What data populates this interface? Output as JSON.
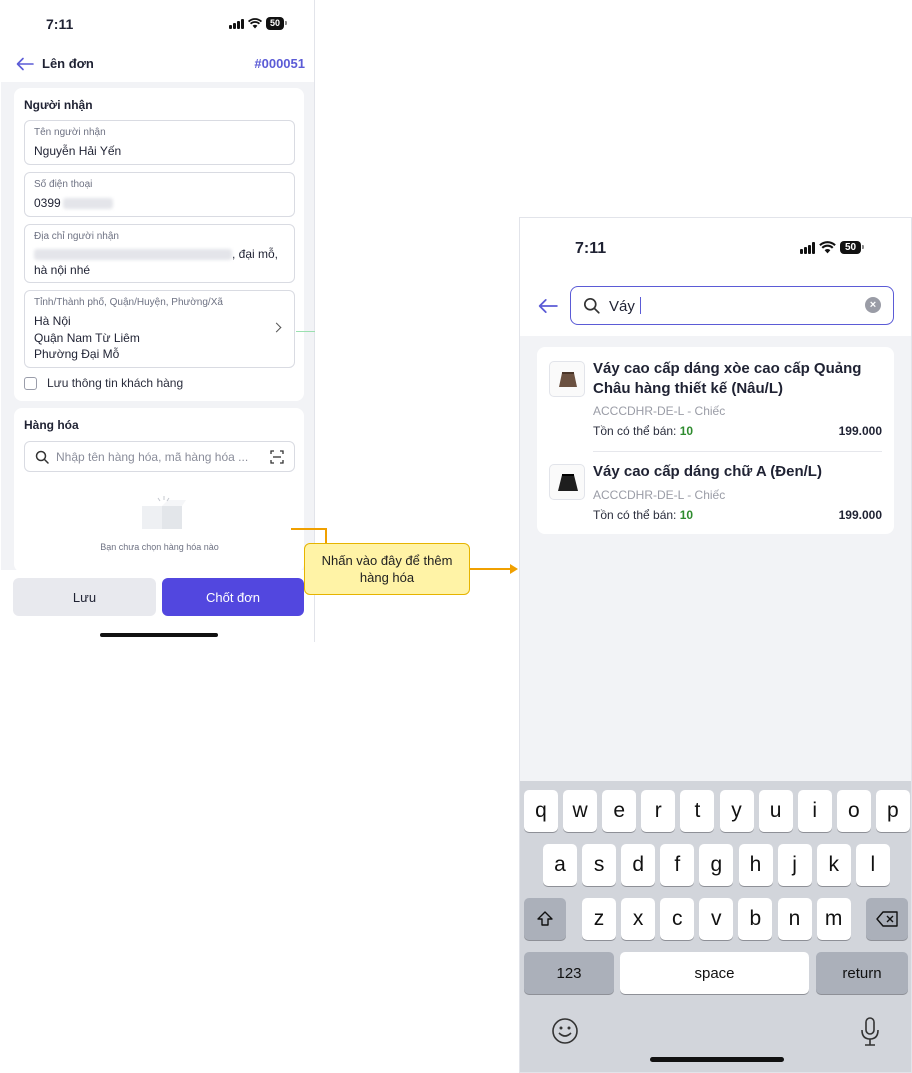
{
  "left_screen": {
    "status_time": "7:11",
    "battery": "50",
    "header": {
      "title": "Lên đơn",
      "order_number": "#000051"
    },
    "recipient": {
      "section_title": "Người nhận",
      "name": {
        "label": "Tên người nhận",
        "value": "Nguyễn Hải Yến"
      },
      "phone": {
        "label": "Số điện thoại",
        "value": "0399"
      },
      "address": {
        "label": "Địa chỉ người nhận",
        "value_line1_tail": ", đại mỗ,",
        "value_line2": "hà nội nhé"
      },
      "region": {
        "label": "Tỉnh/Thành phố, Quận/Huyện, Phường/Xã",
        "province": "Hà Nội",
        "district": "Quận Nam Từ Liêm",
        "ward": "Phường Đại Mỗ"
      },
      "save_customer_label": "Lưu thông tin khách hàng"
    },
    "goods": {
      "section_title": "Hàng hóa",
      "search_placeholder": "Nhập tên hàng hóa, mã hàng hóa ...",
      "empty_text": "Bạn chưa chọn hàng hóa nào"
    },
    "buttons": {
      "save": "Lưu",
      "confirm": "Chốt đơn"
    }
  },
  "callout": {
    "text": "Nhấn vào đây để thêm hàng hóa"
  },
  "right_screen": {
    "status_time": "7:11",
    "battery": "50",
    "search_query": "Váy",
    "results": [
      {
        "name": "Váy cao cấp dáng xòe cao cấp Quảng Châu hàng thiết kế (Nâu/L)",
        "sku": "ACCCDHR-DE-L - Chiếc",
        "stock_label": "Tồn có thể bán:",
        "stock": "10",
        "price": "199.000"
      },
      {
        "name": "Váy cao cấp dáng chữ A (Đen/L)",
        "sku": "ACCCDHR-DE-L - Chiếc",
        "stock_label": "Tồn có thể bán:",
        "stock": "10",
        "price": "199.000"
      }
    ],
    "keyboard": {
      "row1": [
        "q",
        "w",
        "e",
        "r",
        "t",
        "y",
        "u",
        "i",
        "o",
        "p"
      ],
      "row2": [
        "a",
        "s",
        "d",
        "f",
        "g",
        "h",
        "j",
        "k",
        "l"
      ],
      "row3": [
        "z",
        "x",
        "c",
        "v",
        "b",
        "n",
        "m"
      ],
      "numbers": "123",
      "space": "space",
      "return": "return"
    }
  }
}
